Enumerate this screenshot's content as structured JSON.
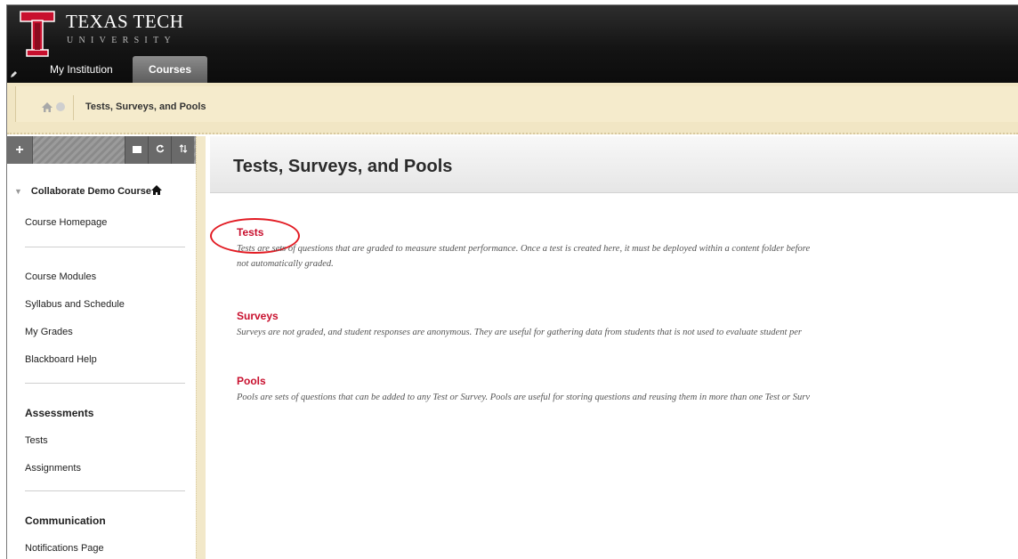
{
  "header": {
    "logo_title": "TEXAS TECH",
    "logo_subtitle": "UNIVERSITY",
    "tabs": [
      {
        "label": "My Institution"
      },
      {
        "label": "Courses",
        "active": true
      }
    ]
  },
  "breadcrumb": {
    "current": "Tests, Surveys, and Pools"
  },
  "leftnav": {
    "toolbar": {
      "add_label": "+"
    },
    "course_title": "Collaborate Demo Course",
    "items": {
      "homepage": "Course Homepage",
      "modules": "Course Modules",
      "syllabus": "Syllabus and Schedule",
      "grades": "My Grades",
      "help": "Blackboard Help"
    },
    "assessments": {
      "header": "Assessments",
      "tests": "Tests",
      "assignments": "Assignments"
    },
    "communication": {
      "header": "Communication",
      "notifications": "Notifications Page"
    }
  },
  "content": {
    "title": "Tests, Surveys, and Pools",
    "sections": [
      {
        "title": "Tests",
        "desc_line1": "Tests are sets of questions that are graded to measure student performance. Once a test is created here, it must be deployed within a content folder before",
        "desc_line2": "not automatically graded."
      },
      {
        "title": "Surveys",
        "desc_line1": "Surveys are not graded, and student responses are anonymous. They are useful for gathering data from students that is not used to evaluate student per"
      },
      {
        "title": "Pools",
        "desc_line1": "Pools are sets of questions that can be added to any Test or Survey. Pools are useful for storing questions and reusing them in more than one Test or Surv"
      }
    ]
  },
  "colors": {
    "accent_red": "#c8102e",
    "annotation_red": "#e21b23",
    "header_dark": "#141414",
    "breadcrumb_tan": "#f1e6c4"
  }
}
